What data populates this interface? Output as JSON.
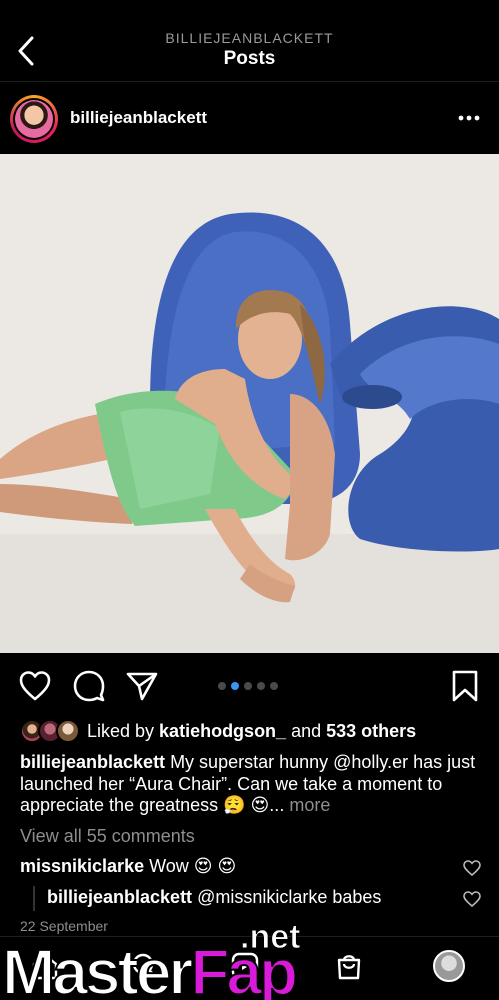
{
  "header": {
    "account_caps": "BILLIEJEANBLACKETT",
    "title": "Posts",
    "back_icon": "chevron-left-icon"
  },
  "post": {
    "username": "billiejeanblackett",
    "more_icon": "more-horizontal-icon",
    "carousel": {
      "count": 5,
      "active_index": 1
    },
    "likes": {
      "prefix": "Liked by ",
      "user": "katiehodgson_",
      "middle": " and ",
      "count": "533 others"
    },
    "caption": {
      "username": "billiejeanblackett",
      "text": " My superstar hunny @holly.er has just launched her “Aura Chair”. Can we take a moment to appreciate the greatness 😮‍💨 😍... ",
      "more": "more"
    },
    "view_comments": "View all 55 comments",
    "comments": [
      {
        "username": "missnikiclarke",
        "text": " Wow 😍 😍"
      },
      {
        "username": "billiejeanblackett",
        "text": " @missnikiclarke babes"
      }
    ],
    "date": "22 September"
  },
  "watermark": {
    "part1": "Master",
    "part2": "Fap",
    "suffix": ".net"
  },
  "colors": {
    "background": "#000000",
    "muted_text": "#8e8e8e",
    "carousel_active": "#3897f0",
    "chair_blue": "#3d5fb5",
    "dress_green": "#7ec98a"
  }
}
